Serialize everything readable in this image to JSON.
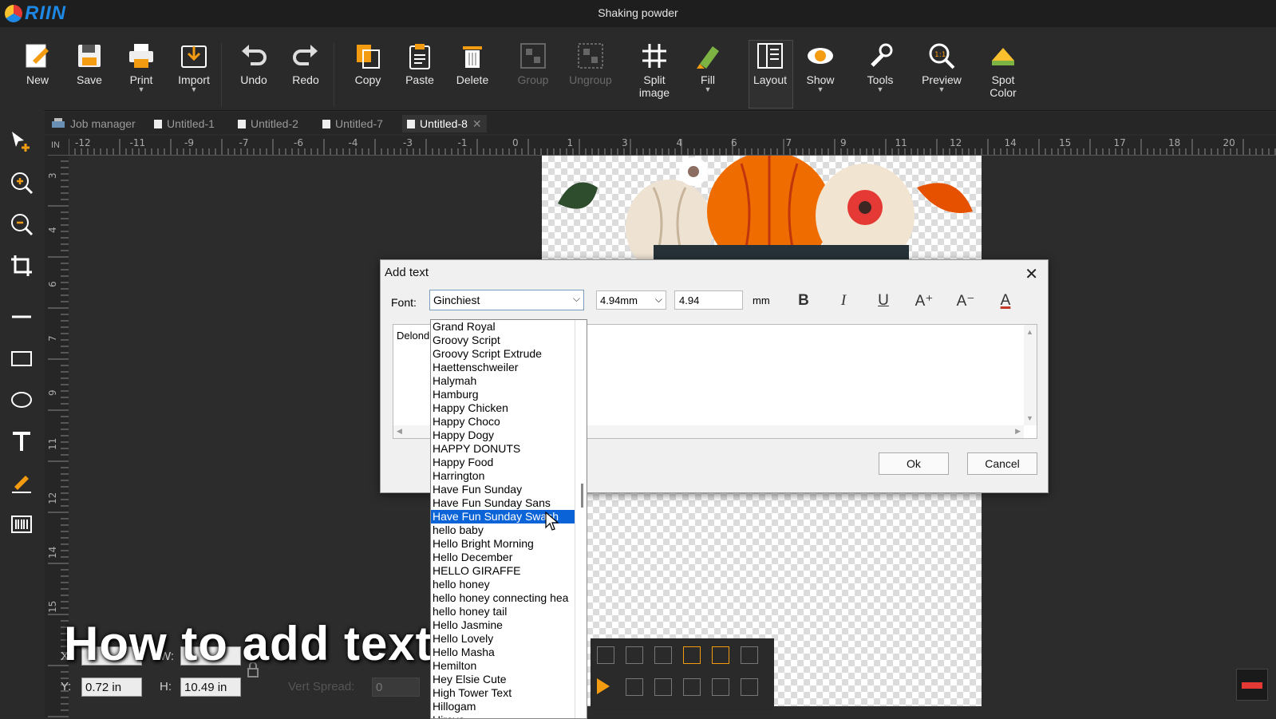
{
  "app": {
    "logo_text": "RIIN",
    "window_title": "Shaking powder"
  },
  "toolbar": {
    "new": "New",
    "save": "Save",
    "print": "Print",
    "import": "Import",
    "undo": "Undo",
    "redo": "Redo",
    "copy": "Copy",
    "paste": "Paste",
    "delete": "Delete",
    "group": "Group",
    "ungroup": "Ungroup",
    "split_line1": "Split",
    "split_line2": "image",
    "fill": "Fill",
    "layout": "Layout",
    "show": "Show",
    "tools": "Tools",
    "preview": "Preview",
    "spot_line1": "Spot",
    "spot_line2": "Color"
  },
  "tabs": {
    "job_manager": "Job manager",
    "t1": "Untitled-1",
    "t2": "Untitled-2",
    "t7": "Untitled-7",
    "t8": "Untitled-8"
  },
  "ruler": {
    "unit": "IN",
    "h_labels": [
      "-12",
      "-11",
      "-9",
      "-7",
      "-6",
      "-4",
      "-3",
      "-1",
      "0",
      "1",
      "3",
      "4",
      "6",
      "7",
      "9",
      "11",
      "12",
      "14",
      "15",
      "17",
      "18",
      "20"
    ],
    "v_labels": [
      "3",
      "4",
      "6",
      "7",
      "9",
      "11",
      "12",
      "14",
      "15"
    ]
  },
  "dialog": {
    "title": "Add text",
    "font_label": "Font:",
    "font_value": "Ginchiest",
    "size_select": "4.94mm",
    "size_value": "4.94",
    "unit": "mm",
    "text_content": "Delond",
    "ok": "Ok",
    "cancel": "Cancel",
    "format": {
      "bold": "B",
      "italic": "I",
      "underline": "U",
      "grow": "A⁺",
      "shrink": "A⁻",
      "color": "A"
    }
  },
  "font_list": [
    "Grand Royal",
    "Groovy Script",
    "Groovy Script Extrude",
    "Haettenschweiler",
    "Halymah",
    "Hamburg",
    "Happy Chicken",
    "Happy Choco",
    "Happy Dogy",
    "HAPPY DONUTS",
    "Happy Food",
    "Harrington",
    "Have Fun Sunday",
    "Have Fun Sunday Sans",
    "Have Fun Sunday Swash",
    "hello baby",
    "Hello Bright Morning",
    "Hello December",
    "HELLO GIRAFFE",
    "hello honey",
    "hello honey connecting hea",
    "hello honey tail",
    "Hello Jasmine",
    "Hello Lovely",
    "Hello Masha",
    "Hemilton",
    "Hey Elsie Cute",
    "High Tower Text",
    "Hillogam",
    "Hiraya"
  ],
  "selected_font": "Have Fun Sunday Swash",
  "position": {
    "y_label": "Y:",
    "y_value": "0.72 in",
    "h_label": "H:",
    "h_value": "10.49 in",
    "x_label": "X:",
    "w_label": "W:",
    "vert_spread_label": "Vert Spread:",
    "vert_spread_value": "0"
  },
  "overlay": {
    "caption": "How to add text"
  },
  "colors": {
    "accent": "#0a64d8",
    "toolbar_bg": "#2a2a2a",
    "canvas_bg": "#2c2c2c"
  }
}
